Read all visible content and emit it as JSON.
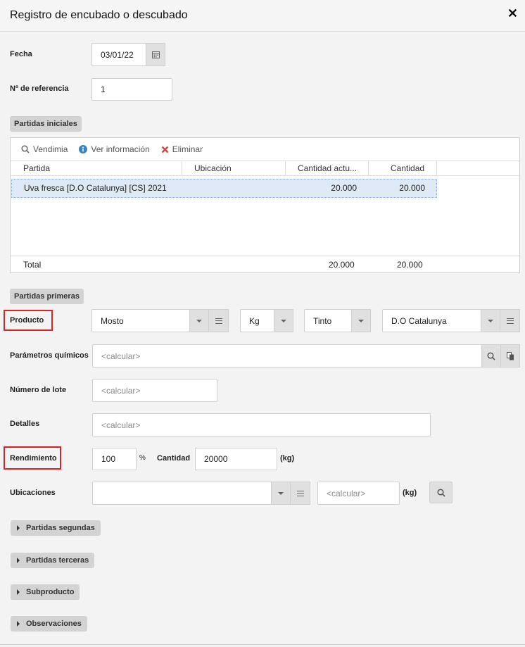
{
  "window": {
    "title": "Registro de encubado o descubado",
    "close_icon": "close-icon"
  },
  "fecha": {
    "label": "Fecha",
    "value": "03/01/22"
  },
  "referencia": {
    "label": "Nº de referencia",
    "value": "1"
  },
  "partidas_iniciales": {
    "section_label": "Partidas iniciales",
    "toolbar": {
      "vendimia": "Vendimia",
      "ver_info": "Ver información",
      "eliminar": "Eliminar"
    },
    "columns": [
      "Partida",
      "Ubicación",
      "Cantidad actu...",
      "Cantidad"
    ],
    "rows": [
      {
        "partida": "Uva fresca [D.O Catalunya] [CS] 2021",
        "ubicacion": "",
        "cantidad_actual": "20.000",
        "cantidad": "20.000"
      }
    ],
    "footer": {
      "label": "Total",
      "cantidad_actual": "20.000",
      "cantidad": "20.000"
    }
  },
  "partidas_primeras": {
    "section_label": "Partidas primeras",
    "producto": {
      "label": "Producto",
      "value": "Mosto",
      "unit": "Kg",
      "color": "Tinto",
      "denominacion": "D.O Catalunya"
    },
    "parametros": {
      "label": "Parámetros químicos",
      "placeholder": "<calcular>"
    },
    "lote": {
      "label": "Número de lote",
      "placeholder": "<calcular>"
    },
    "detalles": {
      "label": "Detalles",
      "placeholder": "<calcular>"
    },
    "rendimiento": {
      "label": "Rendimiento",
      "value": "100",
      "percent": "%",
      "cantidad_label": "Cantidad",
      "cantidad_value": "20000",
      "unit": "(kg)"
    },
    "ubicaciones": {
      "label": "Ubicaciones",
      "value": "",
      "placeholder": "<calcular>",
      "unit": "(kg)"
    }
  },
  "collapsibles": [
    "Partidas segundas",
    "Partidas terceras",
    "Subproducto",
    "Observaciones"
  ],
  "colors": {
    "highlight_border": "#e02020",
    "row_selected": "#dfe8f5",
    "info_blue": "#3b82c4",
    "delete_red": "#e04040"
  }
}
